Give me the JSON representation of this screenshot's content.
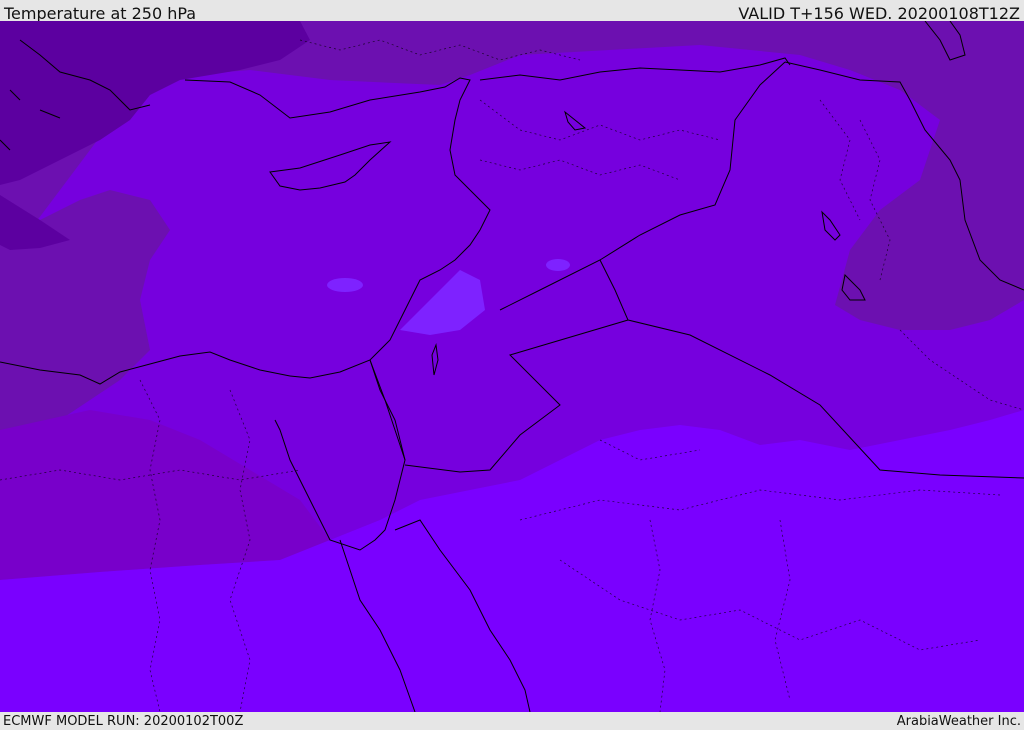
{
  "header": {
    "title": "Temperature at 250 hPa",
    "valid": "VALID T+156 WED. 20200108T12Z"
  },
  "footer": {
    "model_run": "ECMWF MODEL RUN: 20200102T00Z",
    "credit": "ArabiaWeather Inc."
  },
  "colors": {
    "band_coldest": "#5c00a0",
    "band_cold": "#6c10b0",
    "band_mid": "#7800ca",
    "band_main": "#7600de",
    "band_warm": "#7a00ff",
    "spot": "#7e22ff",
    "lines": "#000000"
  }
}
